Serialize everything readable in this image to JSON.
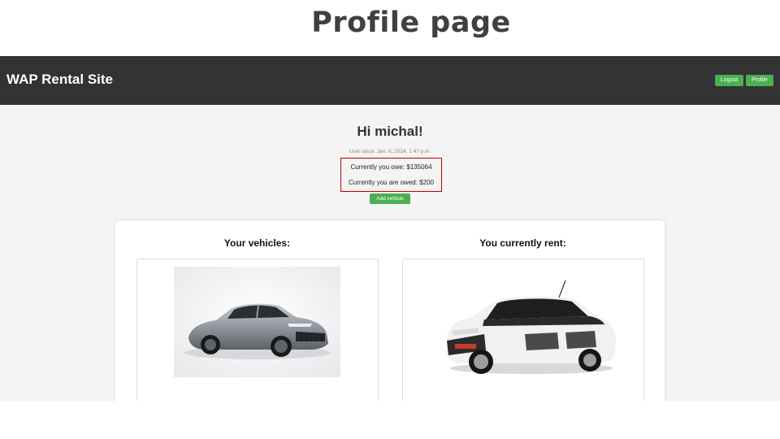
{
  "slide": {
    "title": "Profile page"
  },
  "navbar": {
    "brand": "WAP Rental Site",
    "logout_label": "Logout",
    "profile_label": "Profile"
  },
  "profile": {
    "greeting": "Hi michal!",
    "user_since": "User since: Jan. 6, 2024, 1:47 p.m.",
    "owe_text": "Currently you owe: $135064",
    "owed_text": "Currently you are owed: $200",
    "add_vehicle_label": "Add vehicle"
  },
  "vehicles": {
    "your_title": "Your vehicles:",
    "rent_title": "You currently rent:"
  },
  "colors": {
    "navbar": "#333333",
    "accent": "#4caf50",
    "highlight": "#c00000",
    "background": "#f4f4f4"
  }
}
